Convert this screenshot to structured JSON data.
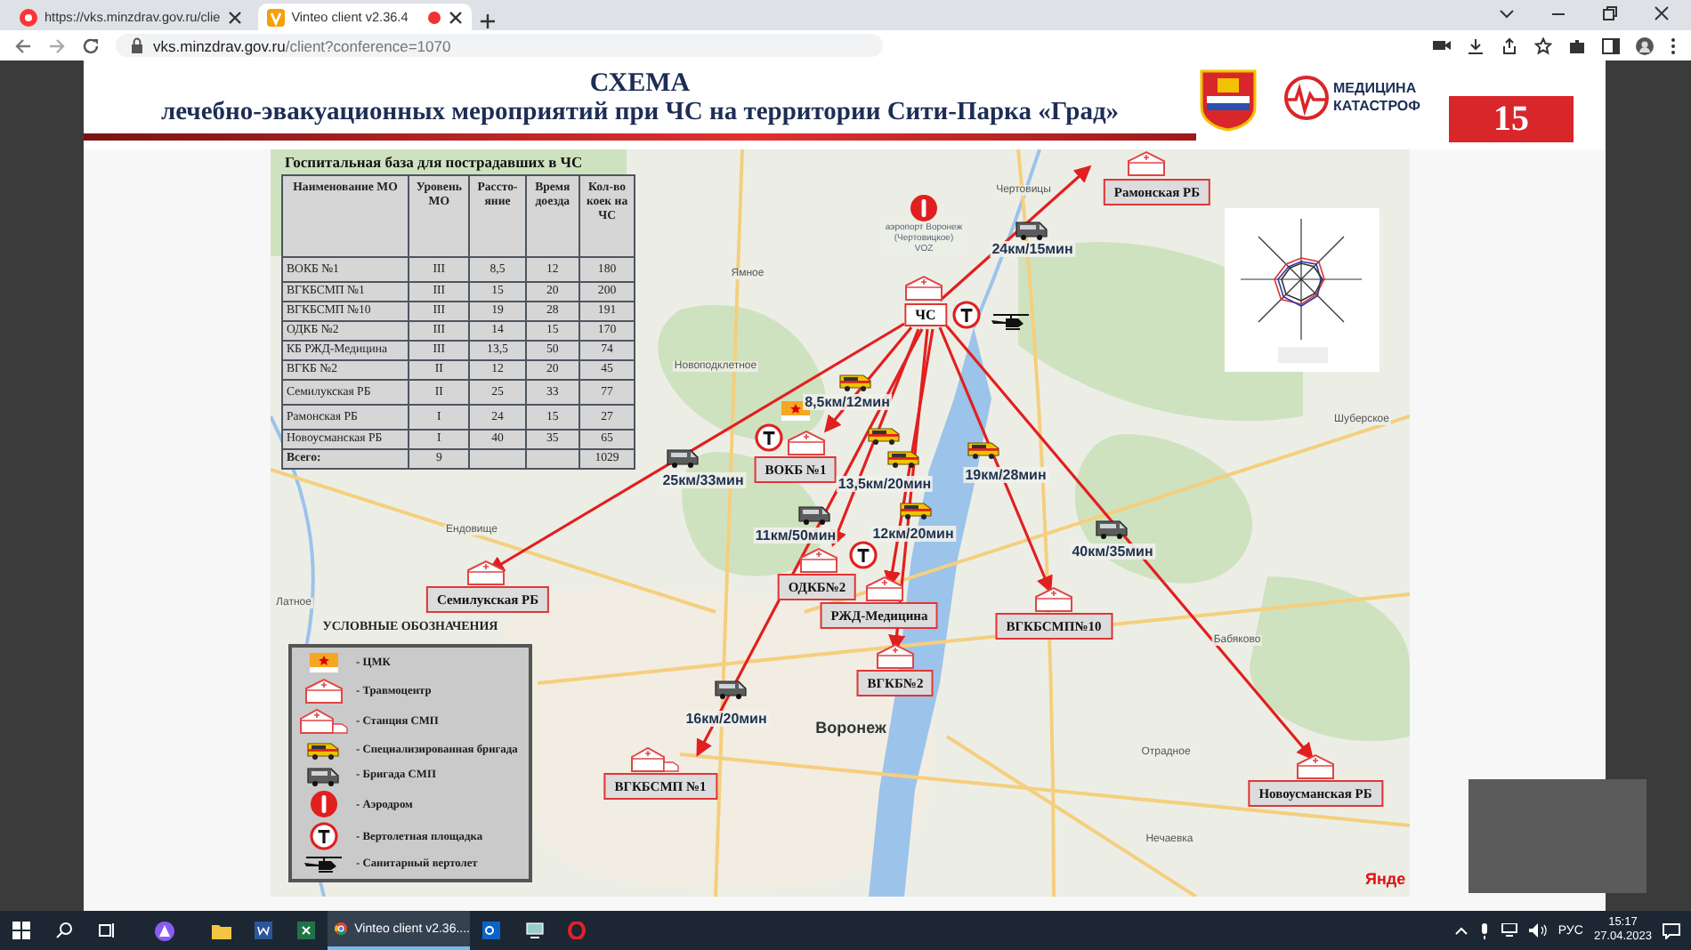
{
  "browser": {
    "tabs": [
      {
        "title": "https://vks.minzdrav.gov.ru/clie",
        "selected": false
      },
      {
        "title": "Vinteo client v2.36.4",
        "selected": true
      }
    ],
    "url_host": "vks.minzdrav.gov.ru",
    "url_path": "/client?conference=1070"
  },
  "slide": {
    "title": "СХЕМА",
    "subtitle": "лечебно-эвакуационных мероприятий при ЧС на территории Сити-Парка «Град»",
    "logo_text": [
      "МЕДИЦИНА",
      "КАТАСТРОФ"
    ],
    "page_number": "15",
    "table": {
      "title": "Госпитальная база для пострадавших в ЧС",
      "columns": [
        "Наименование МО",
        "Уровень МО",
        "Рассто-яние",
        "Время доезда",
        "Кол-во коек на ЧС"
      ],
      "rows": [
        {
          "name": "ВОКБ №1",
          "mo_level": "III",
          "distance": "8,5",
          "time": "12",
          "beds": "180"
        },
        {
          "name": "ВГКБСМП №1",
          "mo_level": "III",
          "distance": "15",
          "time": "20",
          "beds": "200"
        },
        {
          "name": "ВГКБСМП №10",
          "mo_level": "III",
          "distance": "19",
          "time": "28",
          "beds": "191"
        },
        {
          "name": "ОДКБ №2",
          "mo_level": "III",
          "distance": "14",
          "time": "15",
          "beds": "170"
        },
        {
          "name": "КБ РЖД-Медицина",
          "mo_level": "III",
          "distance": "13,5",
          "time": "50",
          "beds": "74"
        },
        {
          "name": "ВГКБ №2",
          "mo_level": "II",
          "distance": "12",
          "time": "20",
          "beds": "45"
        },
        {
          "name": "Семилукская РБ",
          "mo_level": "II",
          "distance": "25",
          "time": "33",
          "beds": "77"
        },
        {
          "name": "Рамонская РБ",
          "mo_level": "I",
          "distance": "24",
          "time": "15",
          "beds": "27"
        },
        {
          "name": "Новоусманская РБ",
          "mo_level": "I",
          "distance": "40",
          "time": "35",
          "beds": "65"
        }
      ],
      "total": {
        "name": "Всего:",
        "mo_level": "9",
        "beds": "1029"
      }
    },
    "legend": {
      "title": "УСЛОВНЫЕ ОБОЗНАЧЕНИЯ",
      "items": [
        {
          "kind": "cmk",
          "label": "- ЦМК"
        },
        {
          "kind": "trauma_center",
          "label": "- Травмоцентр"
        },
        {
          "kind": "smp_station",
          "label": "- Станция СМП"
        },
        {
          "kind": "special_team",
          "label": "- Специализированная бригада"
        },
        {
          "kind": "smp_team",
          "label": "- Бригада СМП"
        },
        {
          "kind": "aerodrome",
          "label": "- Аэродром"
        },
        {
          "kind": "helipad",
          "label": "- Вертолетная площадка"
        },
        {
          "kind": "helicopter",
          "label": "- Санитарный вертолет"
        }
      ]
    },
    "map": {
      "incident": "ЧС",
      "airport": "аэропорт Воронеж (Чертовицкое) VOZ",
      "attribution": "Янде",
      "places": [
        "Чертовицы",
        "Ямное",
        "Новоподклетное",
        "Шуберское",
        "Бабяково",
        "Отрадное",
        "Нечаевка",
        "Латное",
        "Ендовище",
        "Воронеж"
      ],
      "hospitals": [
        {
          "label": "Рамонская РБ"
        },
        {
          "label": "ВОКБ №1"
        },
        {
          "label": "ОДКБ№2"
        },
        {
          "label": "РЖД-Медицина"
        },
        {
          "label": "ВГКБСМП№10"
        },
        {
          "label": "Семилукская РБ"
        },
        {
          "label": "ВГКБ№2"
        },
        {
          "label": "ВГКБСМП №1"
        },
        {
          "label": "Новоусманская РБ"
        }
      ],
      "routes": [
        {
          "label": "24км/15мин",
          "kind": "smp_team"
        },
        {
          "label": "8,5км/12мин",
          "kind": "special_team"
        },
        {
          "label": "25км/33мин",
          "kind": "smp_team"
        },
        {
          "label": "13,5км/20мин",
          "kind": "special_team"
        },
        {
          "label": "19км/28мин",
          "kind": "special_team"
        },
        {
          "label": "11км/50мин",
          "kind": "smp_team"
        },
        {
          "label": "12км/20мин",
          "kind": "special_team"
        },
        {
          "label": "40км/35мин",
          "kind": "smp_team"
        },
        {
          "label": "16км/20мин",
          "kind": "smp_team"
        }
      ]
    }
  },
  "taskbar": {
    "active_app": "Vinteo client v2.36....",
    "language": "РУС",
    "time": "15:17",
    "date": "27.04.2023"
  }
}
